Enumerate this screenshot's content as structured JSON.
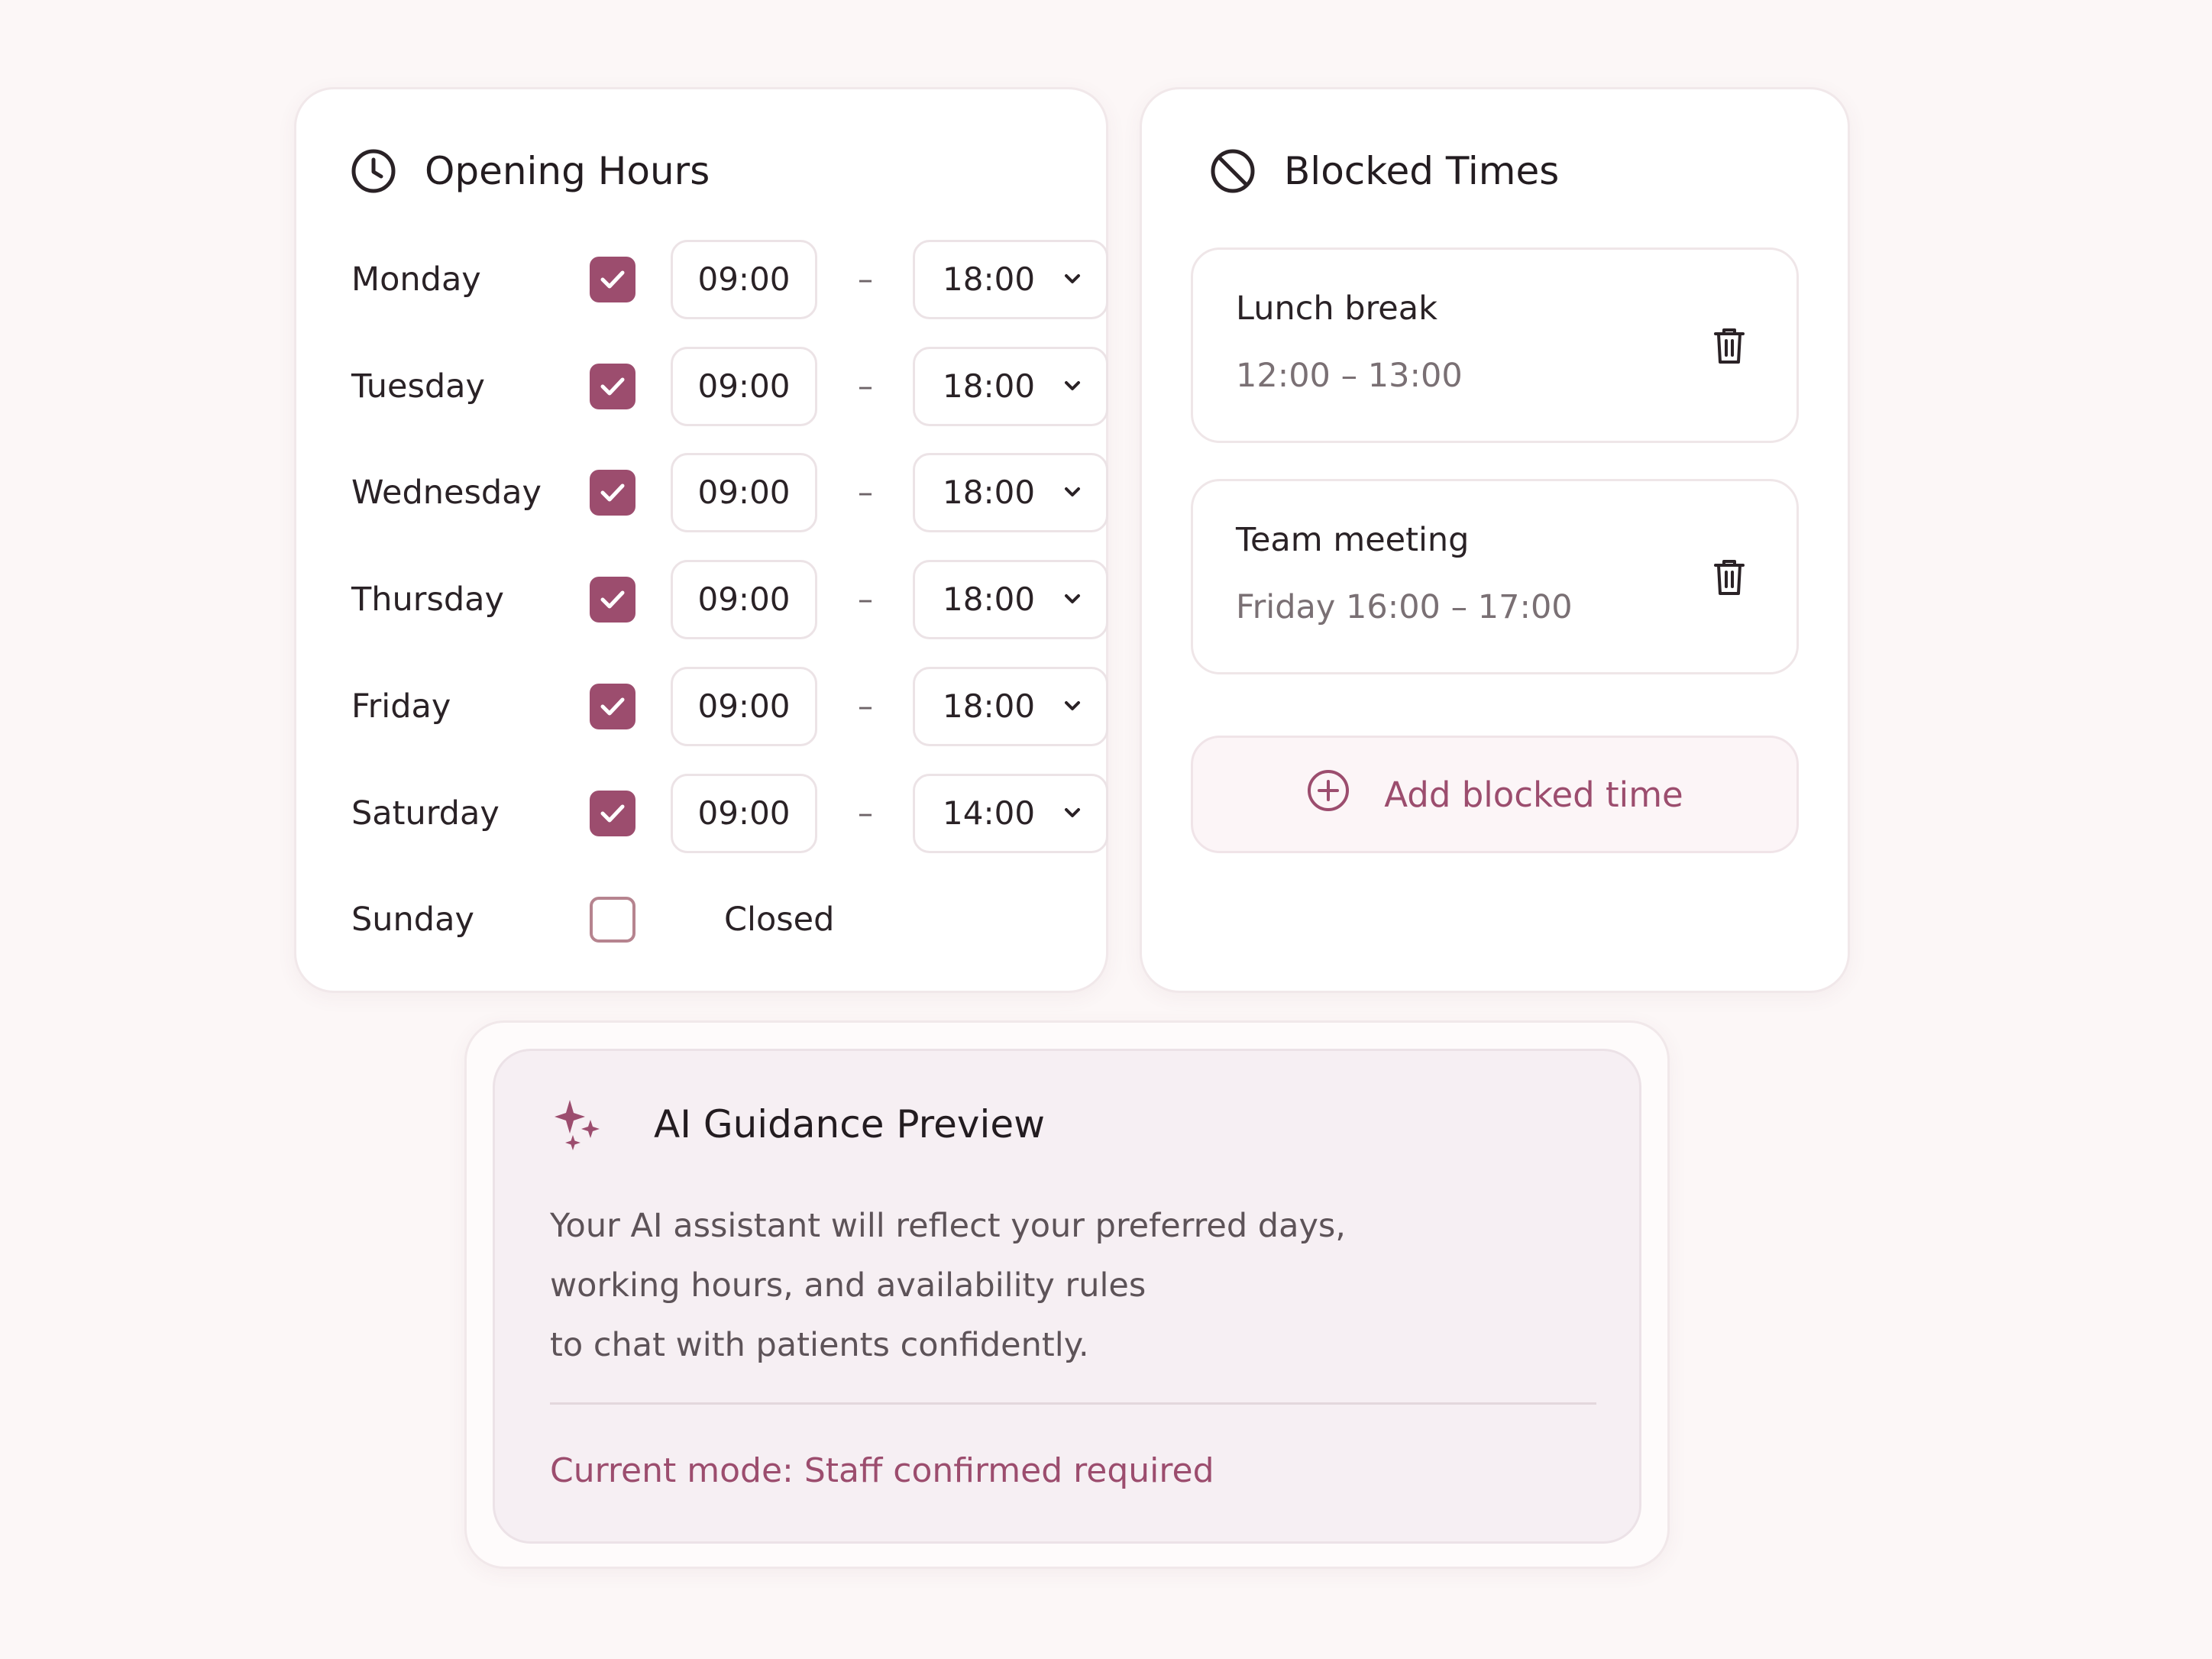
{
  "colors": {
    "accent": "#9c4d6e",
    "background": "#fcf7f7",
    "card": "#ffffff",
    "ai_panel": "#f6eff3",
    "text": "#2a2226",
    "muted_text": "#7a7074"
  },
  "opening_hours": {
    "title": "Opening Hours",
    "icon": "clock-icon",
    "separator": "–",
    "days": [
      {
        "name": "Monday",
        "enabled": true,
        "start": "09:00",
        "end": "18:00"
      },
      {
        "name": "Tuesday",
        "enabled": true,
        "start": "09:00",
        "end": "18:00"
      },
      {
        "name": "Wednesday",
        "enabled": true,
        "start": "09:00",
        "end": "18:00"
      },
      {
        "name": "Thursday",
        "enabled": true,
        "start": "09:00",
        "end": "18:00"
      },
      {
        "name": "Friday",
        "enabled": true,
        "start": "09:00",
        "end": "18:00"
      },
      {
        "name": "Saturday",
        "enabled": true,
        "start": "09:00",
        "end": "14:00"
      },
      {
        "name": "Sunday",
        "enabled": false,
        "closed_label": "Closed"
      }
    ]
  },
  "blocked_times": {
    "title": "Blocked Times",
    "icon": "prohibited-icon",
    "items": [
      {
        "title": "Lunch break",
        "time": "12:00 – 13:00",
        "icon": "trash-icon"
      },
      {
        "title": "Team meeting",
        "time": "Friday 16:00 – 17:00",
        "icon": "trash-icon"
      }
    ],
    "add_label": "Add blocked time",
    "add_icon": "plus-circle-icon"
  },
  "ai_guidance": {
    "title": "AI Guidance Preview",
    "icon": "sparkles-icon",
    "body_lines": [
      "Your AI assistant will reflect your preferred days,",
      "working hours, and availability rules",
      "to chat with patients confidently."
    ],
    "mode": "Current mode: Staff confirmed required"
  }
}
